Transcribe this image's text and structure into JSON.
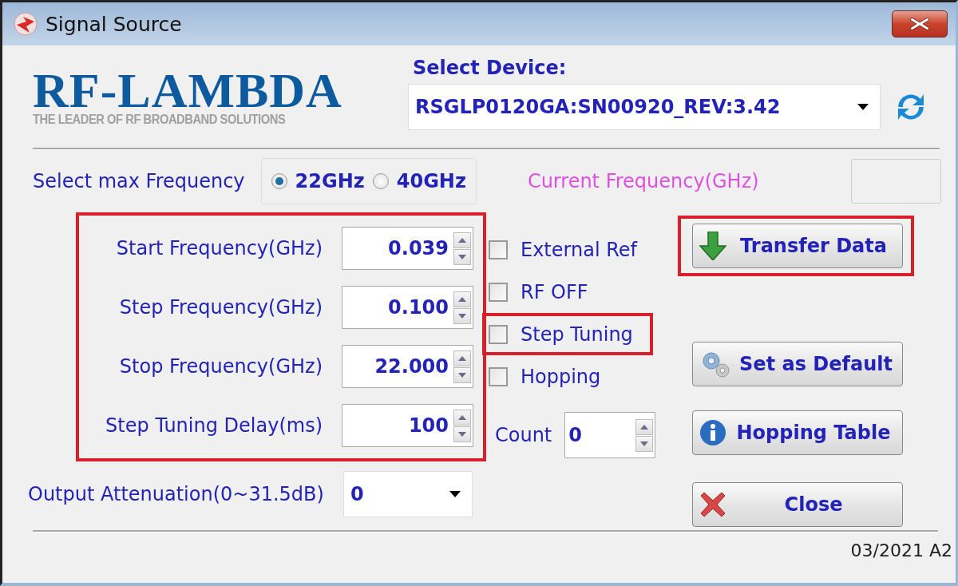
{
  "window": {
    "title": "Signal Source"
  },
  "logo": {
    "name": "RF-LAMBDA",
    "tagline": "THE LEADER OF RF BROADBAND SOLUTIONS"
  },
  "device": {
    "label": "Select Device:",
    "value": "RSGLP0120GA:SN00920_REV:3.42"
  },
  "max_frequency": {
    "label": "Select max Frequency",
    "options": [
      {
        "label": "22GHz",
        "selected": true
      },
      {
        "label": "40GHz",
        "selected": false
      }
    ]
  },
  "current_frequency": {
    "label": "Current Frequency(GHz)"
  },
  "frequency_group": {
    "highlighted": true,
    "fields": [
      {
        "label": "Start Frequency(GHz)",
        "value": "0.039"
      },
      {
        "label": "Step Frequency(GHz)",
        "value": "0.100"
      },
      {
        "label": "Stop Frequency(GHz)",
        "value": "22.000"
      },
      {
        "label": "Step Tuning Delay(ms)",
        "value": "100"
      }
    ]
  },
  "attenuation": {
    "label": "Output Attenuation(0~31.5dB)",
    "value": "0"
  },
  "options": [
    {
      "label": "External Ref",
      "checked": false,
      "highlighted": false
    },
    {
      "label": "RF OFF",
      "checked": false,
      "highlighted": false
    },
    {
      "label": "Step Tuning",
      "checked": false,
      "highlighted": true
    },
    {
      "label": "Hopping",
      "checked": false,
      "highlighted": false
    }
  ],
  "count": {
    "label": "Count",
    "value": "0"
  },
  "buttons": [
    {
      "label": "Transfer Data",
      "kind": "download",
      "highlighted": true
    },
    {
      "label": "Set as Default",
      "kind": "settings",
      "highlighted": false
    },
    {
      "label": "Hopping Table",
      "kind": "info",
      "highlighted": false
    },
    {
      "label": "Close",
      "kind": "close",
      "highlighted": false
    }
  ],
  "footer": "03/2021 A2"
}
